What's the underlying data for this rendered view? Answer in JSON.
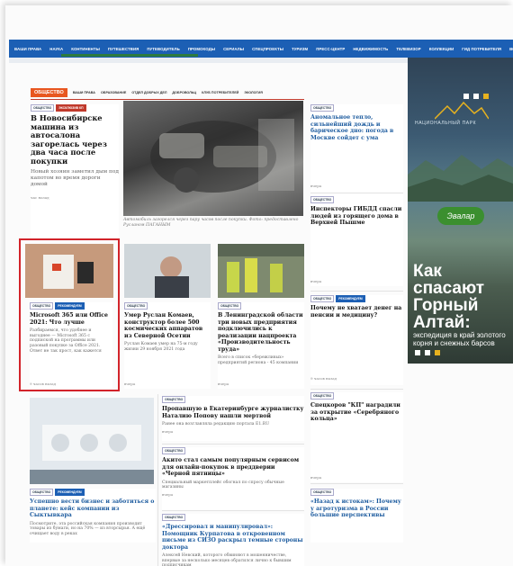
{
  "nav": {
    "items": [
      "ВАШИ ПРАВА",
      "НАУКА",
      "КОНТИНЕНТЫ",
      "ПУТЕШЕСТВИЯ",
      "ПУТЕВОДИТЕЛЬ",
      "ПРОМОКОДЫ",
      "СЕРИАЛЫ",
      "СПЕЦПРОЕКТЫ",
      "ТУРИЗМ",
      "ПРЕСС-ЦЕНТР",
      "НЕДВИЖИМОСТЬ",
      "ТЕЛЕВИЗОР",
      "КОЛЛЕКЦИИ",
      "ГИД ПОТРЕБИТЕЛЯ",
      "ВСЕ"
    ]
  },
  "section": {
    "badge": "ОБЩЕСТВО",
    "subs": [
      "ВАШИ ПРАВА",
      "ОБРАЗОВАНИЕ",
      "ОТДЕЛ ДОБРЫХ ДЕЛ",
      "ДОБРОВОЛЬЦ",
      "КЛУБ ПОТРЕБИТЕЛЕЙ",
      "ЭКОЛОГИЯ"
    ]
  },
  "ad": {
    "park": "НАЦИОНАЛЬНЫЙ ПАРК",
    "brand": "Эвалар",
    "headline": "Как спасают Горный Алтай:",
    "text": "экспедиция в край золотого корня и снежных барсов",
    "colors": {
      "accent": "#e7b21f",
      "green": "#3b8f2f"
    }
  },
  "articles": {
    "main": {
      "tags": [
        "ОБЩЕСТВО",
        "ЭКСКЛЮЗИВ КП"
      ],
      "title": "В Новосибирске машина из автосалона загорелась через два часа после покупки",
      "lead": "Новый хозяин заметил дым под капотом во время дороги домой",
      "time": "час назад",
      "caption": "Автомобиль загорелся через пару часов после покупки. Фото: предоставлено Русланом ПАГАНЫМ"
    },
    "r1": {
      "tags": [
        "ОБЩЕСТВО"
      ],
      "title": "Аномальное тепло, сильнейший дождь и барическое дно: погода в Москве сойдет с ума",
      "time": "вчера"
    },
    "r2": {
      "tags": [
        "ОБЩЕСТВО"
      ],
      "title": "Инспекторы ГИБДД спасли людей из горящего дома в Верхней Пышме",
      "time": "вчера"
    },
    "r3": {
      "tags": [
        "ОБЩЕСТВО",
        "РЕКОМЕНДУЕМ"
      ],
      "title": "Почему не хватает денег на пенсии и медицину?",
      "time": "9 часов назад"
    },
    "r4": {
      "tags": [
        "ОБЩЕСТВО"
      ],
      "title": "Спецкоров \"КП\" наградили за открытие «Серебряного кольца»",
      "time": "вчера"
    },
    "r5": {
      "tags": [
        "ОБЩЕСТВО"
      ],
      "title": "«Назад к истокам»: Почему у агротуризма в России большие перспективы"
    },
    "c1": {
      "tags": [
        "ОБЩЕСТВО",
        "РЕКОМЕНДУЕМ"
      ],
      "title": "Microsoft 365 или Office 2021: Что лучше",
      "lead": "Разбираемся, что удобнее и выгоднее — Microsoft 365 с подпиской на программы или разовый покупке за Office 2021. Ответ не так прост, как кажется",
      "time": "9 часов назад"
    },
    "c2": {
      "tags": [
        "ОБЩЕСТВО"
      ],
      "title": "Умер Руслан Комаев, конструктор более 500 космических аппаратов из Северной Осетии",
      "lead": "Руслан Комаев умер на 75-м году жизни 29 ноября 2021 года",
      "time": "вчера"
    },
    "c3": {
      "tags": [
        "ОБЩЕСТВО"
      ],
      "title": "В Ленинградской области три новых предприятия подключились к реализации нацпроекта «Производительность труда»",
      "lead": "Всего в список «бережливых» предприятий региона - 45 компании",
      "time": "вчера"
    },
    "b1": {
      "tags": [
        "ОБЩЕСТВО",
        "РЕКОМЕНДУЕМ"
      ],
      "title": "Успешно вести бизнес и заботиться о планете: кейс компании из Сыктывкара",
      "lead": "Посмотрите, эта российская компания производит товары из бумаги, но на 70% — из вторсырья. А ещё очищает воду в реках"
    },
    "m1": {
      "tags": [
        "ОБЩЕСТВО"
      ],
      "title": "Пропавшую в Екатеринбурге журналистку Наталию Попову нашли мертвой",
      "lead": "Ранее она возглавляла редакцию портала E1.RU",
      "time": "вчера"
    },
    "m2": {
      "tags": [
        "ОБЩЕСТВО"
      ],
      "title": "Акито стал самым популярным сервисом для онлайн-покупок в преддверии «Черной пятницы»",
      "lead": "Специальный маркетплейс обогнал по спросу обычные магазины",
      "time": "вчера"
    },
    "m3": {
      "tags": [
        "ОБЩЕСТВО"
      ],
      "title": "«Дрессировал и манипулировал»: Помощник Курпатова в откровенном письме из СИЗО раскрыл темные стороны доктора",
      "lead": "Алексей Невский, которого обвиняют в мошенничестве, впервые за несколько месяцев обратился лично к бывшим подписчикам"
    }
  }
}
